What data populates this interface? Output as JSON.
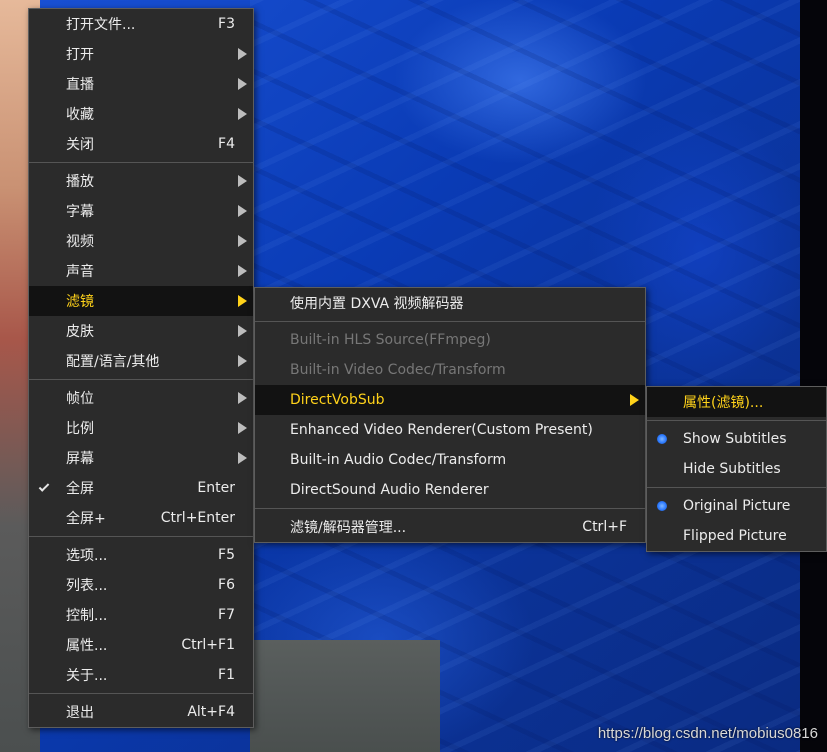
{
  "main_menu": {
    "items": [
      {
        "label": "打开文件...",
        "shortcut": "F3"
      },
      {
        "label": "打开"
      },
      {
        "label": "直播"
      },
      {
        "label": "收藏"
      },
      {
        "label": "关闭",
        "shortcut": "F4"
      },
      {
        "label": "播放"
      },
      {
        "label": "字幕"
      },
      {
        "label": "视频"
      },
      {
        "label": "声音"
      },
      {
        "label": "滤镜"
      },
      {
        "label": "皮肤"
      },
      {
        "label": "配置/语言/其他"
      },
      {
        "label": "帧位"
      },
      {
        "label": "比例"
      },
      {
        "label": "屏幕"
      },
      {
        "label": "全屏",
        "shortcut": "Enter"
      },
      {
        "label": "全屏+",
        "shortcut": "Ctrl+Enter"
      },
      {
        "label": "选项...",
        "shortcut": "F5"
      },
      {
        "label": "列表...",
        "shortcut": "F6"
      },
      {
        "label": "控制...",
        "shortcut": "F7"
      },
      {
        "label": "属性...",
        "shortcut": "Ctrl+F1"
      },
      {
        "label": "关于...",
        "shortcut": "F1"
      },
      {
        "label": "退出",
        "shortcut": "Alt+F4"
      }
    ]
  },
  "filter_menu": {
    "items": [
      {
        "label": "使用内置 DXVA 视频解码器"
      },
      {
        "label": "Built-in HLS Source(FFmpeg)"
      },
      {
        "label": "Built-in Video Codec/Transform"
      },
      {
        "label": "DirectVobSub"
      },
      {
        "label": "Enhanced Video Renderer(Custom Present)"
      },
      {
        "label": "Built-in Audio Codec/Transform"
      },
      {
        "label": "DirectSound Audio Renderer"
      },
      {
        "label": "滤镜/解码器管理...",
        "shortcut": "Ctrl+F"
      }
    ]
  },
  "vobsub_menu": {
    "items": [
      {
        "label": "属性(滤镜)..."
      },
      {
        "label": "Show Subtitles"
      },
      {
        "label": "Hide Subtitles"
      },
      {
        "label": "Original Picture"
      },
      {
        "label": "Flipped Picture"
      }
    ]
  },
  "watermark": "https://blog.csdn.net/mobius0816",
  "colors": {
    "menu_bg": "#2b2b2b",
    "highlight_bg": "#121212",
    "highlight_text": "#ffd21a",
    "text": "#ececec",
    "disabled_text": "#777777"
  }
}
